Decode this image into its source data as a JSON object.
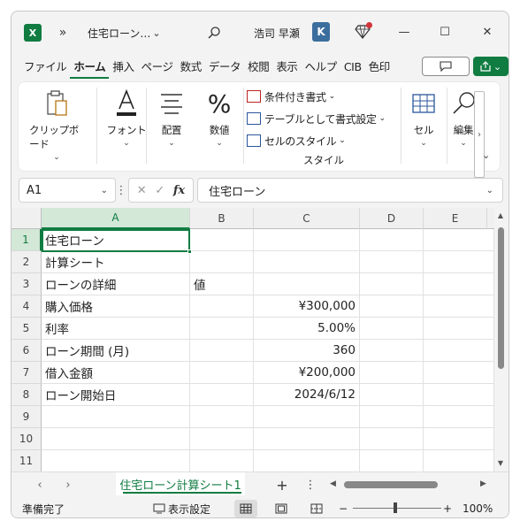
{
  "titlebar": {
    "app_icon": "X",
    "more": "»",
    "doc_title": "住宅ローン…",
    "title_chevron": "⌄",
    "user_name": "浩司 早瀬",
    "avatar_letter": "K",
    "minimize": "—",
    "maximize": "☐",
    "close": "✕"
  },
  "tabs": [
    "ファイル",
    "ホーム",
    "挿入",
    "ページ",
    "数式",
    "データ",
    "校閲",
    "表示",
    "ヘルプ",
    "CIB",
    "色印"
  ],
  "active_tab": "ホーム",
  "ribbon": {
    "clipboard": "クリップボード",
    "font": "フォント",
    "align": "配置",
    "number": "数値",
    "number_symbol": "%",
    "cond_format": "条件付き書式",
    "table_format": "テーブルとして書式設定",
    "cell_style": "セルのスタイル",
    "style_group": "スタイル",
    "cells": "セル",
    "edit": "編集",
    "chev": "⌄",
    "scroll_right": "›",
    "collapse": "⌄"
  },
  "formula_bar": {
    "name_box": "A1",
    "name_chev": "⌄",
    "dots": "⋮",
    "cancel": "✕",
    "enter": "✓",
    "fx": "fx",
    "content": "住宅ローン",
    "expand": "⌄"
  },
  "sheet": {
    "columns": [
      "A",
      "B",
      "C",
      "D",
      "E"
    ],
    "rows": [
      "1",
      "2",
      "3",
      "4",
      "5",
      "6",
      "7",
      "8",
      "9",
      "10",
      "11"
    ],
    "cells": {
      "A1": "住宅ローン",
      "A2": "計算シート",
      "A3": "ローンの詳細",
      "B3": "値",
      "A4": "購入価格",
      "C4": "¥300,000",
      "A5": "利率",
      "C5": "5.00%",
      "A6": "ローン期間 (月)",
      "C6": "360",
      "A7": "借入金額",
      "C7": "¥200,000",
      "A8": "ローン開始日",
      "C8": "2024/6/12"
    },
    "active_cell": "A1"
  },
  "sheet_tabs": {
    "prev": "‹",
    "next": "›",
    "active_sheet": "住宅ローン計算シート1",
    "add": "+",
    "menu": "⋮",
    "scroll_left": "◀",
    "scroll_right": "▶"
  },
  "status": {
    "ready": "準備完了",
    "display_settings": "表示設定",
    "zoom_minus": "−",
    "zoom_plus": "+",
    "zoom": "100%"
  },
  "colors": {
    "accent": "#107c41",
    "notify": "#d13438"
  }
}
